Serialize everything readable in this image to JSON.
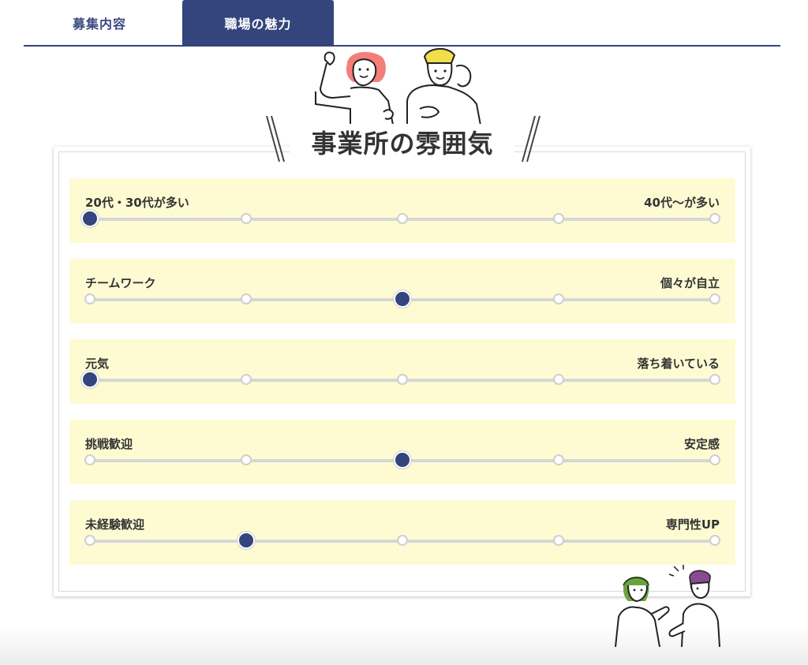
{
  "tabs": [
    {
      "label": "募集内容",
      "active": false
    },
    {
      "label": "職場の魅力",
      "active": true
    }
  ],
  "section_title": "事業所の雰囲気",
  "colors": {
    "navy": "#33457c",
    "row_bg": "#fefbd3",
    "track": "#d6d6d6"
  },
  "scales": [
    {
      "left": "20代・30代が多い",
      "right": "40代〜が多い",
      "value": 0
    },
    {
      "left": "チームワーク",
      "right": "個々が自立",
      "value": 2
    },
    {
      "left": "元気",
      "right": "落ち着いている",
      "value": 0
    },
    {
      "left": "挑戦歓迎",
      "right": "安定感",
      "value": 2
    },
    {
      "left": "未経験歓迎",
      "right": "専門性UP",
      "value": 1
    }
  ],
  "scale_steps": 5
}
